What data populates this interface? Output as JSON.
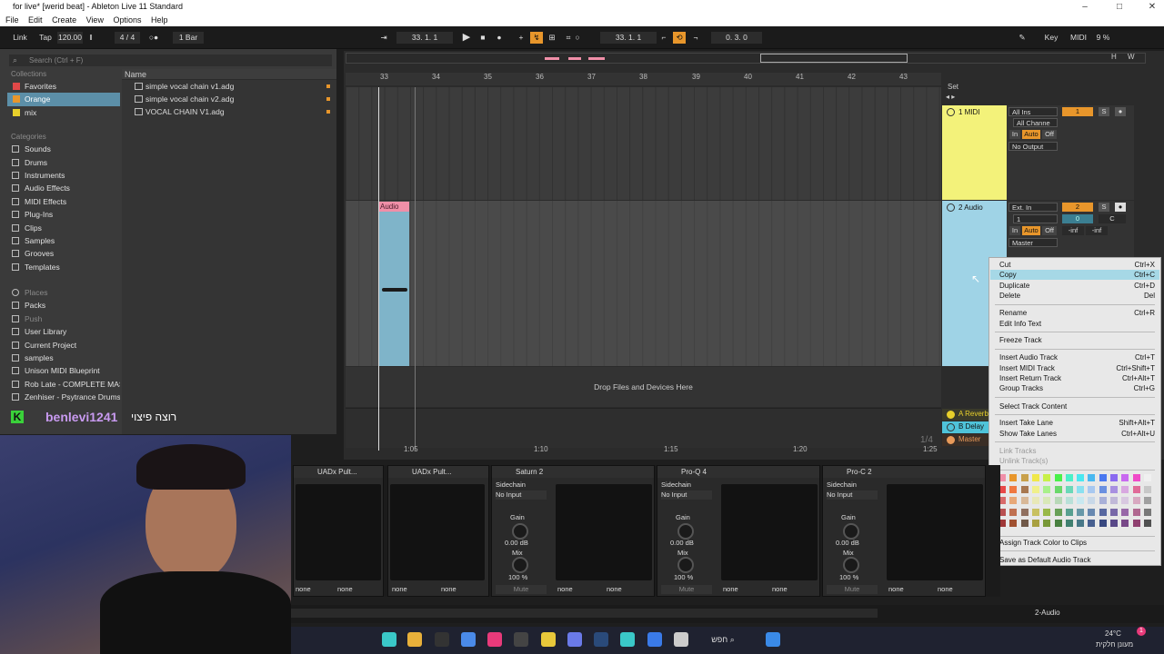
{
  "window": {
    "title": "for live* [werid beat] - Ableton Live 11 Standard",
    "controls": [
      "–",
      "□",
      "✕"
    ]
  },
  "menu": [
    "File",
    "Edit",
    "Create",
    "View",
    "Options",
    "Help"
  ],
  "transport": {
    "link": "Link",
    "tap": "Tap",
    "tempo": "120.00",
    "time_sig": "4 / 4",
    "metronome": "○●",
    "quantize": "1 Bar",
    "arrangement_position": "33.   1.   1",
    "loop_start": "33.   1.   1",
    "loop_length": "0.   3.   0",
    "key": "Key",
    "midi": "MIDI",
    "cpu": "9 %"
  },
  "browser": {
    "search_placeholder": "Search (Ctrl + F)",
    "collections_title": "Collections",
    "collections": [
      {
        "label": "Favorites",
        "color": "#e04848"
      },
      {
        "label": "Orange",
        "color": "#e8962b"
      },
      {
        "label": "mix",
        "color": "#e8d02b"
      }
    ],
    "categories_title": "Categories",
    "categories": [
      "Sounds",
      "Drums",
      "Instruments",
      "Audio Effects",
      "MIDI Effects",
      "Plug-Ins",
      "Clips",
      "Samples",
      "Grooves",
      "Templates"
    ],
    "places_title": "Places",
    "places": [
      "Packs",
      "Push",
      "User Library",
      "Current Project",
      "samples",
      "Unison MIDI Blueprint",
      "Rob Late - COMPLETE MAST",
      "Zenhiser - Psytrance Drums"
    ],
    "name_header": "Name",
    "files": [
      "simple vocal chain v1.adg",
      "simple vocal chain v2.adg",
      "VOCAL CHAIN V1.adg"
    ]
  },
  "overlay_text": {
    "channel": "benlevi1241",
    "message": "רוצה פיצוי"
  },
  "arrangement": {
    "ruler": [
      "33",
      "34",
      "35",
      "36",
      "37",
      "38",
      "39",
      "40",
      "41",
      "42",
      "43"
    ],
    "time_ruler": [
      "1:05",
      "1:10",
      "1:15",
      "1:20",
      "1:25"
    ],
    "drop_text": "Drop Files and Devices Here",
    "clip_name": "Audio",
    "set_label": "Set",
    "page_indicator": "1/4"
  },
  "tracks": {
    "midi": {
      "name": "1 MIDI",
      "color": "#f3f27a",
      "input": "All Ins",
      "channel": "All Channe",
      "monitor_in": "In",
      "monitor_auto": "Auto",
      "monitor_off": "Off",
      "output": "No Output",
      "number": "1",
      "solo": "S"
    },
    "audio": {
      "name": "2 Audio",
      "color": "#9fd3e6",
      "input": "Ext. In",
      "channel": "1",
      "monitor_in": "In",
      "monitor_auto": "Auto",
      "monitor_off": "Off",
      "output": "Master",
      "number": "2",
      "solo": "S",
      "vol": "0",
      "pan": "C",
      "inf1": "-inf",
      "inf2": "-inf"
    },
    "returns": [
      {
        "name": "A Reverb",
        "color": "#e8d02b"
      },
      {
        "name": "B Delay",
        "color": "#4fc3d9"
      },
      {
        "name": "Master",
        "color": "#e89a5a"
      }
    ]
  },
  "context_menu": {
    "items": [
      {
        "label": "Cut",
        "shortcut": "Ctrl+X",
        "state": "normal"
      },
      {
        "label": "Copy",
        "shortcut": "Ctrl+C",
        "state": "highlight"
      },
      {
        "label": "Duplicate",
        "shortcut": "Ctrl+D",
        "state": "normal"
      },
      {
        "label": "Delete",
        "shortcut": "Del",
        "state": "normal"
      },
      {
        "label": "Rename",
        "shortcut": "Ctrl+R",
        "state": "normal"
      },
      {
        "label": "Edit Info Text",
        "shortcut": "",
        "state": "normal"
      },
      {
        "label": "Freeze Track",
        "shortcut": "",
        "state": "normal"
      },
      {
        "label": "Insert Audio Track",
        "shortcut": "Ctrl+T",
        "state": "normal"
      },
      {
        "label": "Insert MIDI Track",
        "shortcut": "Ctrl+Shift+T",
        "state": "normal"
      },
      {
        "label": "Insert Return Track",
        "shortcut": "Ctrl+Alt+T",
        "state": "normal"
      },
      {
        "label": "Group Tracks",
        "shortcut": "Ctrl+G",
        "state": "normal"
      },
      {
        "label": "Select Track Content",
        "shortcut": "",
        "state": "normal"
      },
      {
        "label": "Insert Take Lane",
        "shortcut": "Shift+Alt+T",
        "state": "normal"
      },
      {
        "label": "Show Take Lanes",
        "shortcut": "Ctrl+Alt+U",
        "state": "normal"
      },
      {
        "label": "Link Tracks",
        "shortcut": "",
        "state": "disabled"
      },
      {
        "label": "Unlink Track(s)",
        "shortcut": "",
        "state": "disabled"
      },
      {
        "label": "Assign Track Color to Clips",
        "shortcut": "",
        "state": "normal"
      },
      {
        "label": "Save as Default Audio Track",
        "shortcut": "",
        "state": "normal"
      }
    ],
    "palette": [
      "#f08fa8",
      "#e8962b",
      "#c8a04a",
      "#f0e84a",
      "#c8f04a",
      "#4af04a",
      "#4af0c8",
      "#4ae8f0",
      "#4ab8f0",
      "#4a78f0",
      "#8a6af0",
      "#c86af0",
      "#f04ac8",
      "#f0f0f0",
      "#e84848",
      "#f07840",
      "#a87850",
      "#f0f08a",
      "#a8f08a",
      "#6ad86a",
      "#6ad8b8",
      "#8ae0f0",
      "#a8c8f0",
      "#6a90e0",
      "#a890e0",
      "#d8a8e0",
      "#e06a98",
      "#c8c8c8",
      "#d86a6a",
      "#e8a878",
      "#d8b898",
      "#e8e8b8",
      "#d8e8b8",
      "#b8d8b8",
      "#b8e0d8",
      "#c8e8f0",
      "#c8d8e8",
      "#a8b0d8",
      "#c0b8d8",
      "#d8c8e0",
      "#d8a8c0",
      "#a0a0a0",
      "#b85050",
      "#c07050",
      "#907060",
      "#c8c060",
      "#98b848",
      "#68a058",
      "#58a090",
      "#6898a8",
      "#6888b0",
      "#5868a0",
      "#7868a8",
      "#9868a8",
      "#b06890",
      "#787878",
      "#a03838",
      "#a05030",
      "#705848",
      "#a8a040",
      "#789838",
      "#488040",
      "#408070",
      "#487888",
      "#486090",
      "#384880",
      "#584888",
      "#784888",
      "#904070",
      "#505050"
    ]
  },
  "devices": [
    {
      "name": "UADx Pult...",
      "none1": "none",
      "none2": "none"
    },
    {
      "name": "UADx Pult...",
      "none1": "none",
      "none2": "none"
    },
    {
      "name": "Saturn 2",
      "sidechain": "Sidechain",
      "input": "No Input",
      "gain_label": "Gain",
      "gain": "0.00 dB",
      "mix_label": "Mix",
      "mix": "100 %",
      "mute": "Mute",
      "none1": "none",
      "none2": "none"
    },
    {
      "name": "Pro-Q 4",
      "sidechain": "Sidechain",
      "input": "No Input",
      "gain_label": "Gain",
      "gain": "0.00 dB",
      "mix_label": "Mix",
      "mix": "100 %",
      "mute": "Mute",
      "none1": "none",
      "none2": "none"
    },
    {
      "name": "Pro-C 2",
      "sidechain": "Sidechain",
      "input": "No Input",
      "gain_label": "Gain",
      "gain": "0.00 dB",
      "mix_label": "Mix",
      "mix": "100 %",
      "mute": "Mute",
      "none1": "none",
      "none2": "none"
    }
  ],
  "status": {
    "track": "2-Audio"
  },
  "taskbar": {
    "search": "חפש",
    "temp": "24°C",
    "weather": "מעונן חלקית",
    "notif": "1"
  }
}
